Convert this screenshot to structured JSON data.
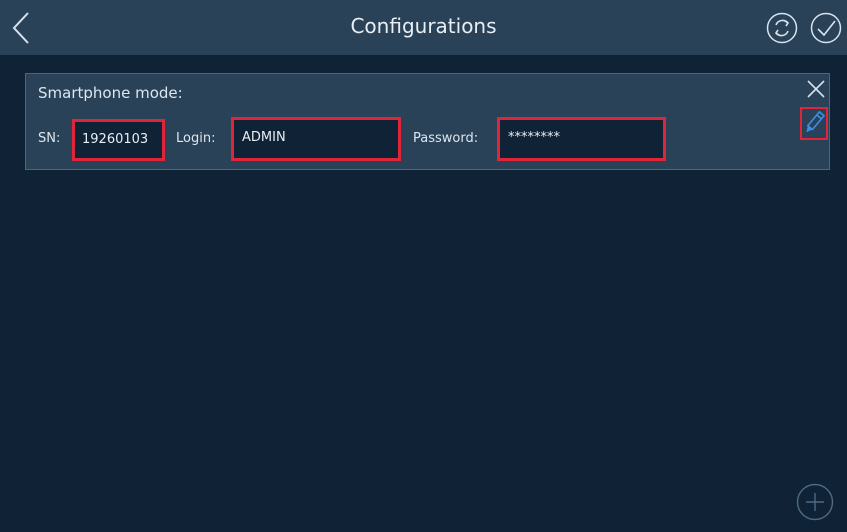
{
  "header": {
    "title": "Configurations",
    "icons": {
      "back": "chevron-left-icon",
      "sync": "sync-icon",
      "confirm": "check-icon"
    }
  },
  "card": {
    "title": "Smartphone mode:",
    "sn_label": "SN:",
    "sn_value": "19260103",
    "login_label": "Login:",
    "login_value": "ADMIN",
    "password_label": "Password:",
    "password_value": "********",
    "icons": {
      "close": "close-icon",
      "edit": "pencil-icon"
    }
  },
  "fab": {
    "icon": "plus-icon"
  },
  "colors": {
    "background": "#0f2236",
    "bar": "#2a4258",
    "highlight": "#e0243a",
    "edit_icon": "#3a8ee6"
  }
}
